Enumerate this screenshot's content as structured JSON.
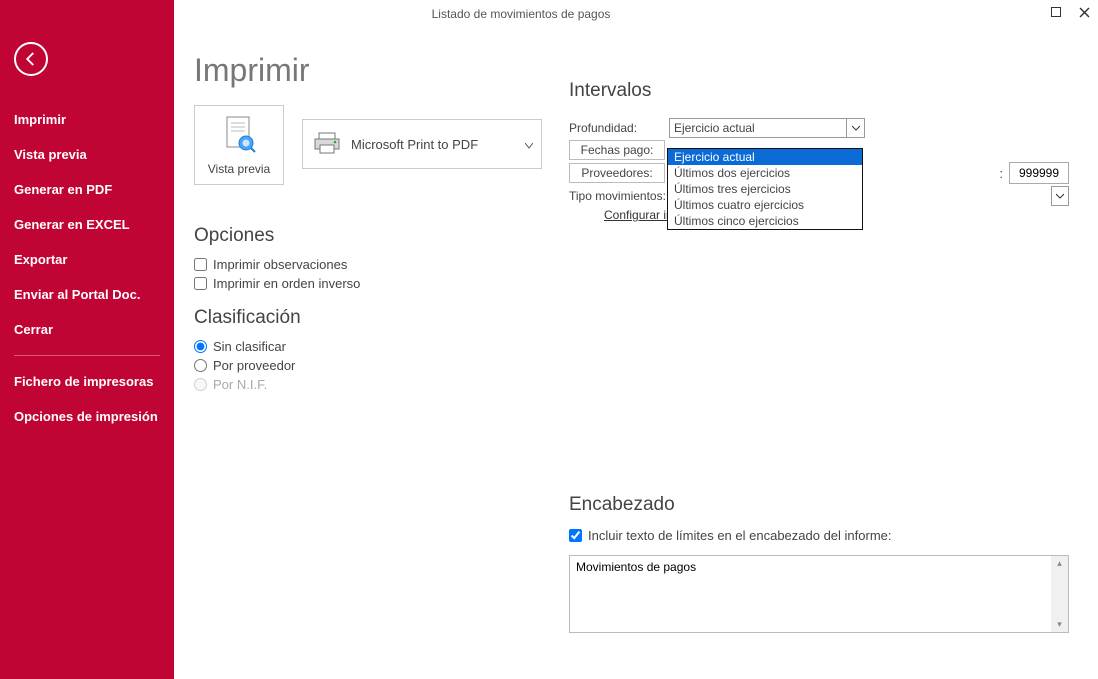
{
  "window": {
    "title": "Listado de movimientos de pagos"
  },
  "sidebar": {
    "items": [
      "Imprimir",
      "Vista previa",
      "Generar en PDF",
      "Generar en EXCEL",
      "Exportar",
      "Enviar al Portal Doc.",
      "Cerrar"
    ],
    "items2": [
      "Fichero de impresoras",
      "Opciones de impresión"
    ]
  },
  "page": {
    "title": "Imprimir",
    "preview_label": "Vista previa",
    "printer_name": "Microsoft Print to PDF",
    "config_link": "Configurar impresora"
  },
  "opciones": {
    "title": "Opciones",
    "chk_obs": "Imprimir observaciones",
    "chk_inv": "Imprimir en orden inverso"
  },
  "clasificacion": {
    "title": "Clasificación",
    "r1": "Sin clasificar",
    "r2": "Por proveedor",
    "r3": "Por N.I.F."
  },
  "intervalos": {
    "title": "Intervalos",
    "profundidad_label": "Profundidad:",
    "profundidad_value": "Ejercicio actual",
    "profundidad_options": [
      "Ejercicio actual",
      "Últimos dos ejercicios",
      "Últimos tres ejercicios",
      "Últimos cuatro ejercicios",
      "Últimos cinco ejercicios"
    ],
    "fechas_label": "Fechas pago:",
    "proveedores_label": "Proveedores:",
    "proveedores_to": "999999",
    "tipo_label": "Tipo movimientos:"
  },
  "encabezado": {
    "title": "Encabezado",
    "chk": "Incluir texto de límites en el encabezado del informe:",
    "text": "Movimientos de pagos"
  }
}
